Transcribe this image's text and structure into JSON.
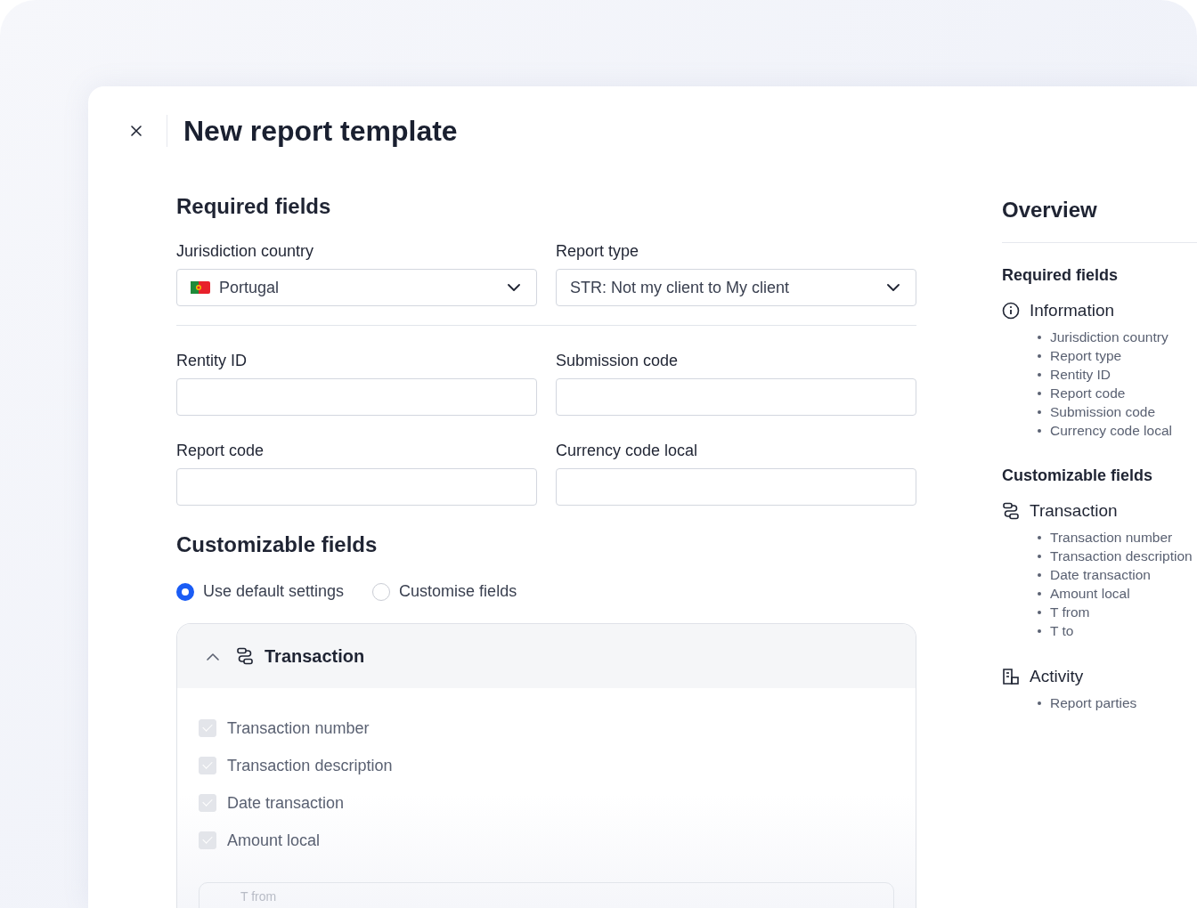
{
  "title": "New report template",
  "required": {
    "heading": "Required fields",
    "rows": [
      [
        {
          "kind": "country-select",
          "label": "Jurisdiction country",
          "value": "Portugal"
        },
        {
          "kind": "select",
          "label": "Report type",
          "value": "STR: Not my client to My client"
        }
      ],
      [
        {
          "kind": "text",
          "label": "Rentity ID"
        },
        {
          "kind": "text",
          "label": "Submission code"
        }
      ],
      [
        {
          "kind": "text",
          "label": "Report code"
        },
        {
          "kind": "text",
          "label": "Currency code local"
        }
      ]
    ]
  },
  "customizable": {
    "heading": "Customizable fields",
    "radios": [
      {
        "label": "Use default settings",
        "selected": true
      },
      {
        "label": "Customise fields",
        "selected": false
      }
    ],
    "group": {
      "title": "Transaction",
      "expanded": true,
      "items": [
        {
          "label": "Transaction number",
          "checked": true,
          "disabled": true
        },
        {
          "label": "Transaction description",
          "checked": true,
          "disabled": true
        },
        {
          "label": "Date transaction",
          "checked": true,
          "disabled": true
        },
        {
          "label": "Amount local",
          "checked": true,
          "disabled": true
        }
      ],
      "subgroup": {
        "label": "T from"
      }
    }
  },
  "overview": {
    "title": "Overview",
    "sections": [
      {
        "heading": "Required fields",
        "groups": [
          {
            "kind": "info",
            "title": "Information",
            "items": [
              "Jurisdiction country",
              "Report type",
              "Rentity ID",
              "Report code",
              "Submission code",
              "Currency code local"
            ]
          }
        ]
      },
      {
        "heading": "Customizable fields",
        "groups": [
          {
            "kind": "transaction",
            "title": "Transaction",
            "items": [
              "Transaction number",
              "Transaction description",
              "Date transaction",
              "Amount local",
              "T from",
              "T to"
            ]
          },
          {
            "kind": "activity",
            "title": "Activity",
            "items": [
              "Report parties"
            ]
          }
        ]
      }
    ]
  }
}
